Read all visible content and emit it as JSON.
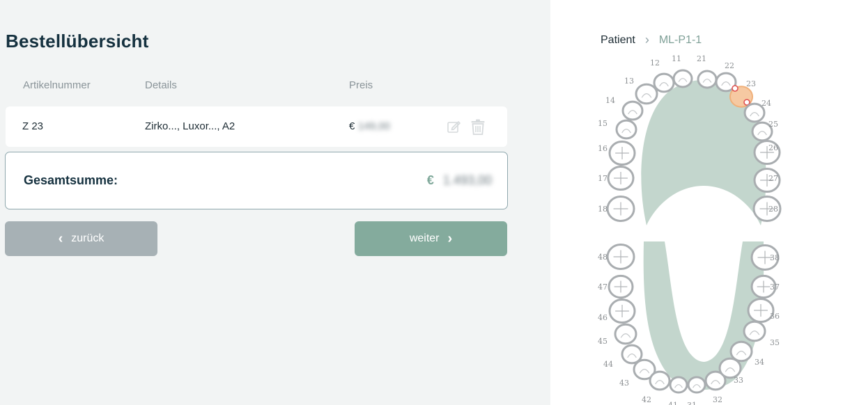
{
  "page": {
    "title": "Bestellübersicht"
  },
  "table": {
    "columns": [
      "Artikelnummer",
      "Details",
      "Preis"
    ],
    "row": {
      "article": "Z 23",
      "details": "Zirko..., Luxor..., A2",
      "currency": "€",
      "price": "149,00"
    }
  },
  "total": {
    "label": "Gesamtsumme:",
    "currency": "€",
    "value": "1.493,00"
  },
  "buttons": {
    "back_label": "zurück",
    "next_label": "weiter"
  },
  "breadcrumb": {
    "patient": "Patient",
    "id": "ML-P1-1"
  },
  "teeth": {
    "upper": [
      "18",
      "17",
      "16",
      "15",
      "14",
      "13",
      "12",
      "11",
      "21",
      "22",
      "23",
      "24",
      "25",
      "26",
      "27",
      "28"
    ],
    "lower": [
      "48",
      "47",
      "46",
      "45",
      "44",
      "43",
      "42",
      "41",
      "31",
      "32",
      "33",
      "34",
      "35",
      "36",
      "37",
      "38"
    ],
    "selected": "23"
  },
  "colors": {
    "accent": "#84ab9d",
    "back": "#a7b1b5",
    "selected_tooth": "#f6c9a2",
    "marker": "#e05050"
  }
}
